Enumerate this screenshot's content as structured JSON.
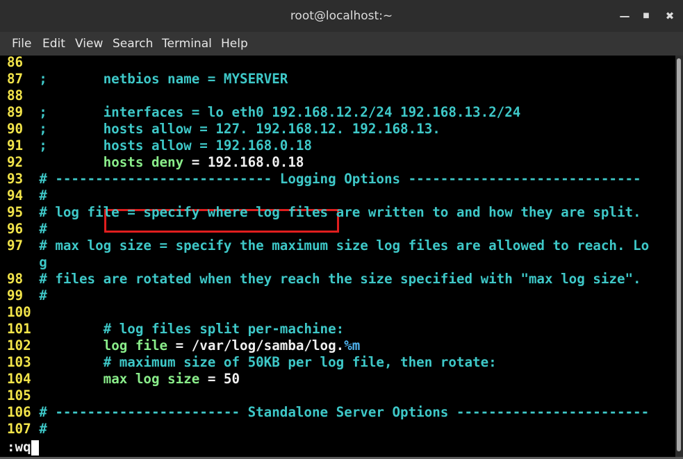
{
  "window": {
    "title": "root@localhost:~",
    "minimize": "—",
    "maximize": "■",
    "close": "✖"
  },
  "menu": {
    "file": "File",
    "edit": "Edit",
    "view": "View",
    "search": "Search",
    "terminal": "Terminal",
    "help": "Help"
  },
  "lines": [
    {
      "num": "86",
      "text": ""
    },
    {
      "num": "87",
      "text": ";       netbios name = MYSERVER"
    },
    {
      "num": "88",
      "text": ""
    },
    {
      "num": "89",
      "text": ";       interfaces = lo eth0 192.168.12.2/24 192.168.13.2/24"
    },
    {
      "num": "90",
      "text": ";       hosts allow = 127. 192.168.12. 192.168.13."
    },
    {
      "num": "91",
      "text": ";       hosts allow = 192.168.0.18"
    },
    {
      "num": "92",
      "indent": "        ",
      "key": "hosts deny",
      "eq": " = ",
      "value": "192.168.0.18"
    },
    {
      "num": "93",
      "text": "# --------------------------- Logging Options -----------------------------"
    },
    {
      "num": "94",
      "text": "#"
    },
    {
      "num": "95",
      "text": "# log file = specify where log files are written to and how they are split."
    },
    {
      "num": "96",
      "text": "#"
    },
    {
      "num": "97",
      "text": "# max log size = specify the maximum size log files are allowed to reach. Lo"
    },
    {
      "num": "",
      "text": "g"
    },
    {
      "num": "98",
      "text": "# files are rotated when they reach the size specified with \"max log size\"."
    },
    {
      "num": "99",
      "text": "#"
    },
    {
      "num": "100",
      "text": ""
    },
    {
      "num": "101",
      "text": "        # log files split per-machine:"
    },
    {
      "num": "102",
      "indent": "        ",
      "key": "log file",
      "eq": " = ",
      "value": "/var/log/samba/log.",
      "special": "%m"
    },
    {
      "num": "103",
      "text": "        # maximum size of 50KB per log file, then rotate:"
    },
    {
      "num": "104",
      "indent": "        ",
      "key": "max log size",
      "eq": " = ",
      "value": "50"
    },
    {
      "num": "105",
      "text": ""
    },
    {
      "num": "106",
      "text": "# ----------------------- Standalone Server Options ------------------------"
    },
    {
      "num": "107",
      "text": "#"
    }
  ],
  "command": ":wq",
  "colors": {
    "line_number": "#f2e44a",
    "comment": "#3ec8c8",
    "keyword": "#8aed8a",
    "highlight_border": "#e01e1e"
  }
}
